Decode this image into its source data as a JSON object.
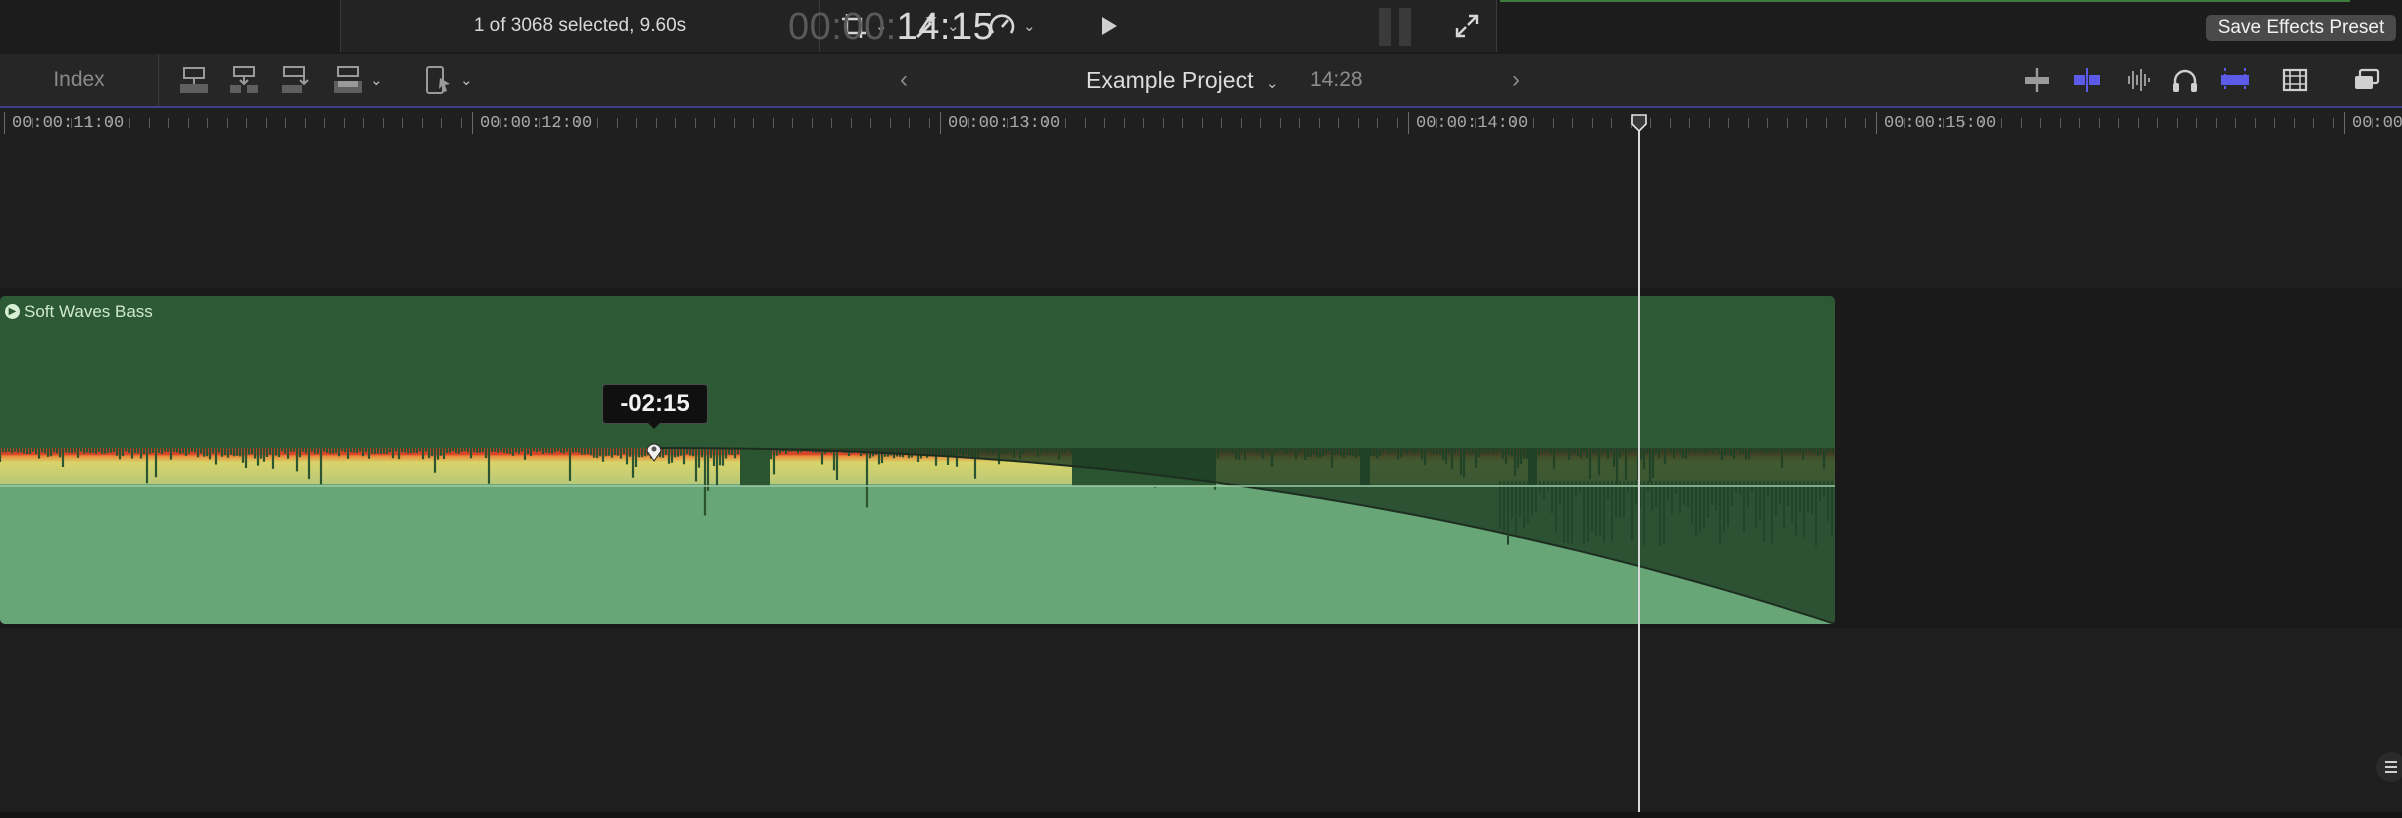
{
  "viewer": {
    "selection_info": "1 of 3068 selected, 9.60s",
    "timecode_dim": "00:00:",
    "timecode_bright": "14:15",
    "icons": [
      "crop-icon",
      "magic-wand-icon",
      "speed-icon",
      "play-icon",
      "fullscreen-icon"
    ],
    "save_effects_preset": "Save Effects Preset"
  },
  "toolbar": {
    "index_label": "Index",
    "project_name": "Example Project",
    "project_duration": "14:28"
  },
  "ruler": {
    "labels": [
      "00:00:11:00",
      "00:00:12:00",
      "00:00:13:00",
      "00:00:14:00",
      "00:00:15:00",
      "00:00"
    ]
  },
  "clip": {
    "name": "Soft Waves Bass",
    "fade_label": "-02:15"
  },
  "colors": {
    "clip_fill": "#2d5a35",
    "wave_fill": "#68a577",
    "peak_red": "#d94428",
    "peak_yellow": "#d8d46a",
    "accent_blue": "#5b5be8"
  }
}
